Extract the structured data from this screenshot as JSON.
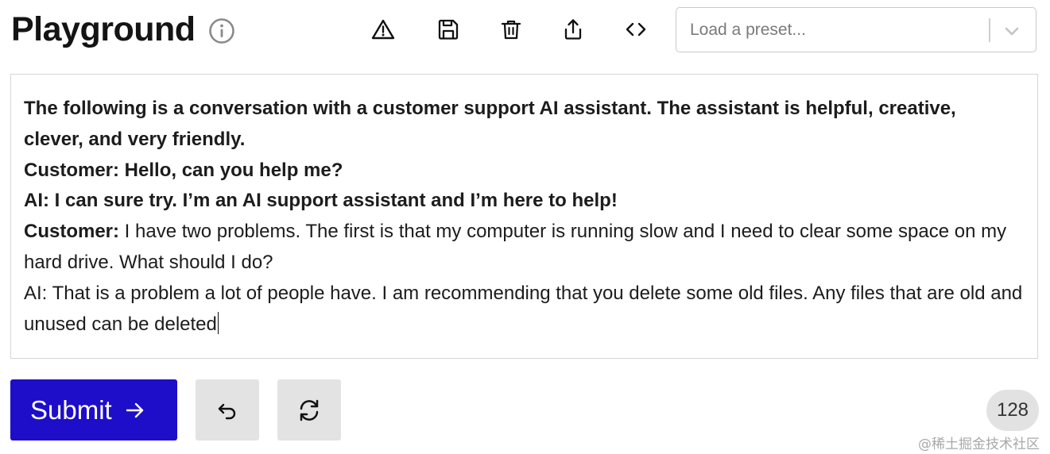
{
  "header": {
    "title": "Playground",
    "info_icon": "info-circle-icon",
    "toolbar_icons": [
      "warning-icon",
      "save-icon",
      "trash-icon",
      "share-icon",
      "code-icon"
    ]
  },
  "preset": {
    "placeholder": "Load a preset...",
    "icon": "chevron-down-icon"
  },
  "editor": {
    "bold_line1": "The following is a conversation with a customer support AI assistant. The assistant is helpful, creative,",
    "bold_line2": "clever, and very friendly.",
    "bold_line3": "Customer: Hello, can you help me?",
    "bold_line4": "AI: I can sure try. I’m an AI support assistant and I’m here to help!",
    "customer_prefix": "Customer:",
    "customer_text": " I have two problems. The first is that my computer is running slow and I need to clear some space on my hard drive. What should I do?",
    "ai_text": "AI: That is a problem a lot of people have. I am recommending that you delete some old files. Any files that are old and unused can be deleted"
  },
  "actions": {
    "submit_label": "Submit",
    "submit_icon": "arrow-right-icon",
    "undo_icon": "undo-icon",
    "regenerate_icon": "refresh-icon"
  },
  "token_count": "128",
  "watermark": "@稀土掘金技术社区",
  "colors": {
    "submit_bg": "#1e0ec9",
    "secondary_button_bg": "#e3e3e3",
    "token_badge_bg": "#e2e2e2"
  }
}
